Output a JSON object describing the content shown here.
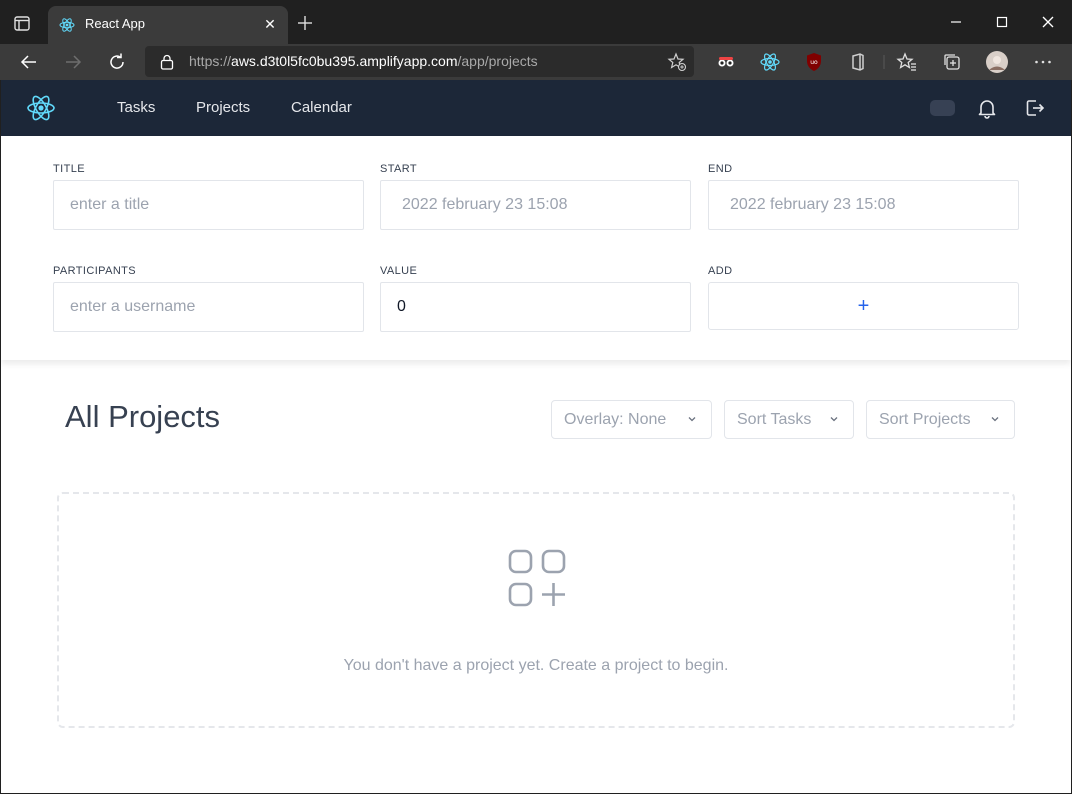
{
  "browser": {
    "tab_title": "React App",
    "tab_close": "✕",
    "url_scheme": "https://",
    "url_host": "aws.d3t0l5fc0bu395.amplifyapp.com",
    "url_path": "/app/projects"
  },
  "nav": {
    "links": [
      "Tasks",
      "Projects",
      "Calendar"
    ],
    "accent": "#1c2738"
  },
  "form": {
    "title_label": "TITLE",
    "title_placeholder": "enter a title",
    "start_label": "START",
    "start_value": "2022 february 23 15:08",
    "end_label": "END",
    "end_value": "2022 february 23 15:08",
    "participants_label": "PARTICIPANTS",
    "participants_placeholder": "enter a username",
    "value_label": "VALUE",
    "value_value": "0",
    "add_label": "ADD",
    "add_button": "+"
  },
  "main": {
    "heading": "All Projects",
    "overlay_dropdown": "Overlay: None",
    "sort_tasks_dropdown": "Sort Tasks",
    "sort_projects_dropdown": "Sort Projects",
    "empty_message": "You don't have a project yet. Create a project to begin."
  },
  "icons": {
    "browser": [
      "sidebar-icon",
      "react-favicon",
      "close-icon",
      "new-tab-icon",
      "minimize-icon",
      "maximize-icon",
      "window-close-icon",
      "back-icon",
      "forward-icon",
      "refresh-icon",
      "lock-icon",
      "favorite-add-icon",
      "extension-icons",
      "favorites-icon",
      "collections-icon",
      "profile-avatar",
      "more-icon"
    ],
    "app": [
      "react-logo",
      "dark-mode-toggle",
      "bell-icon",
      "logout-icon",
      "chevron-down-icon",
      "add-project-icon"
    ]
  }
}
